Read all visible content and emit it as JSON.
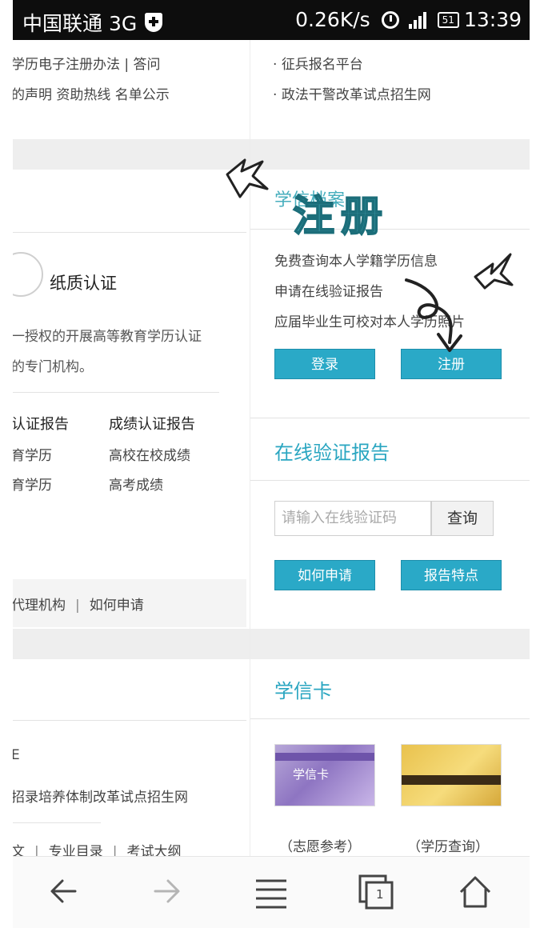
{
  "status_bar": {
    "carrier": "中国联通 3G",
    "speed": "0.26K/s",
    "battery": "51",
    "time": "13:39"
  },
  "left": {
    "top_link_1": "学历电子注册办法 | 答问",
    "top_link_2": "的声明 资助热线 名单公示",
    "paper_cert_title": "纸质认证",
    "paper_cert_desc_1": "一授权的开展高等教育学历认证",
    "paper_cert_desc_2": "的专门机构。",
    "report_col1_title": "认证报告",
    "report_col2_title": "成绩认证报告",
    "report_col1_item1": "育学历",
    "report_col1_item2": "育学历",
    "report_col2_item1": "高校在校成绩",
    "report_col2_item2": "高考成绩",
    "links_row": {
      "agency": "代理机构",
      "how_apply": "如何申请"
    },
    "bottom_label": "E",
    "recruit_line": "招录培养体制改革试点招生网",
    "bottom_links": {
      "a": "文",
      "b": "专业目录",
      "c": "考试大纲"
    }
  },
  "right": {
    "top_link_1": "征兵报名平台",
    "top_link_2": "政法干警改革试点招生网",
    "xuexin_title": "学信档案",
    "xuexin_items": [
      "免费查询本人学籍学历信息",
      "申请在线验证报告",
      "应届毕业生可校对本人学历照片"
    ],
    "login_btn": "登录",
    "register_btn": "注册",
    "online_report_title": "在线验证报告",
    "code_placeholder": "请输入在线验证码",
    "query_btn": "查询",
    "how_apply_btn": "如何申请",
    "report_feature_btn": "报告特点",
    "card_title": "学信卡",
    "card1_text": "学信卡",
    "card1_caption": "（志愿参考）",
    "card2_caption": "（学历查询）"
  },
  "doodle": {
    "text": "注册"
  },
  "nav": {
    "back": "back-arrow-icon",
    "forward": "forward-arrow-icon",
    "menu": "menu-icon",
    "tabs_count": "1",
    "home": "home-icon"
  },
  "colors": {
    "teal": "#2aa9c7",
    "title_teal": "#2aa6c1",
    "status_bar": "#0d0d0d"
  }
}
